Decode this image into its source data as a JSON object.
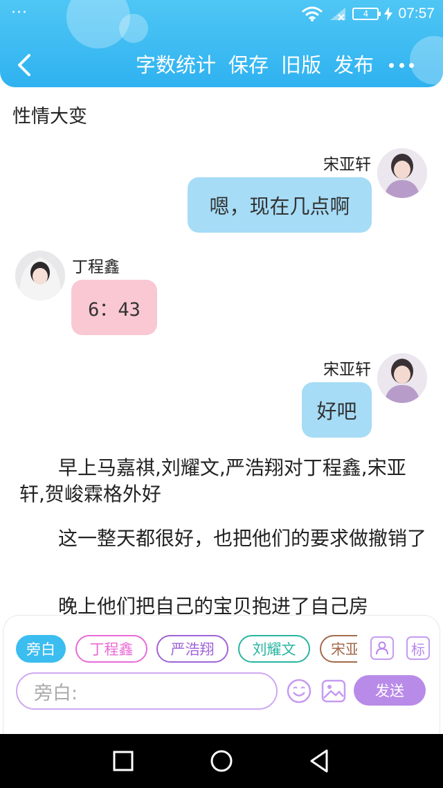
{
  "status_bar": {
    "menu_dots": "···",
    "battery_level": "4",
    "time": "07:57"
  },
  "toolbar": {
    "actions": [
      "字数统计",
      "保存",
      "旧版",
      "发布"
    ]
  },
  "document": {
    "title": "性情大变"
  },
  "messages": [
    {
      "speaker": "宋亚轩",
      "text": "嗯，现在几点啊",
      "side": "right",
      "bubble_color": "#a6dcf6"
    },
    {
      "speaker": "丁程鑫",
      "text": "6：43",
      "side": "left",
      "bubble_color": "#f9c8d3"
    },
    {
      "speaker": "宋亚轩",
      "text": "好吧",
      "side": "right",
      "bubble_color": "#a6dcf6"
    }
  ],
  "narration": [
    "　　早上马嘉祺,刘耀文,严浩翔对丁程鑫,宋亚轩,贺峻霖格外好",
    "　　这一整天都很好，也把他们的要求做撤销了",
    "　　晚上他们把自己的宝贝抱进了自己房"
  ],
  "composer": {
    "role_chips": [
      {
        "label": "旁白",
        "color": "#3bbdf0",
        "active": true
      },
      {
        "label": "丁程鑫",
        "color": "#e86ad6"
      },
      {
        "label": "严浩翔",
        "color": "#a063d8"
      },
      {
        "label": "刘耀文",
        "color": "#27b5a0"
      },
      {
        "label": "宋亚",
        "color": "#a36a4a"
      }
    ],
    "tag_icon_label": "标",
    "input_placeholder": "旁白:",
    "send_label": "发送"
  },
  "colors": {
    "header": "#2fb2f0",
    "accent_purple": "#b98be8"
  }
}
